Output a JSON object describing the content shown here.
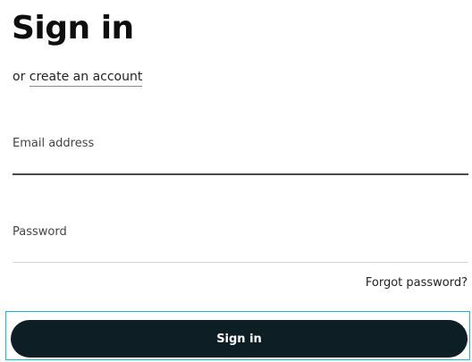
{
  "heading": "Sign in",
  "alt_prefix": "or",
  "create_account_label": "create an account",
  "email": {
    "label": "Email address",
    "value": ""
  },
  "password": {
    "label": "Password",
    "value": ""
  },
  "forgot_password_label": "Forgot password?",
  "submit_label": "Sign in",
  "colors": {
    "button_bg": "#0d1e25",
    "focus_outline": "#1fb3d9"
  }
}
